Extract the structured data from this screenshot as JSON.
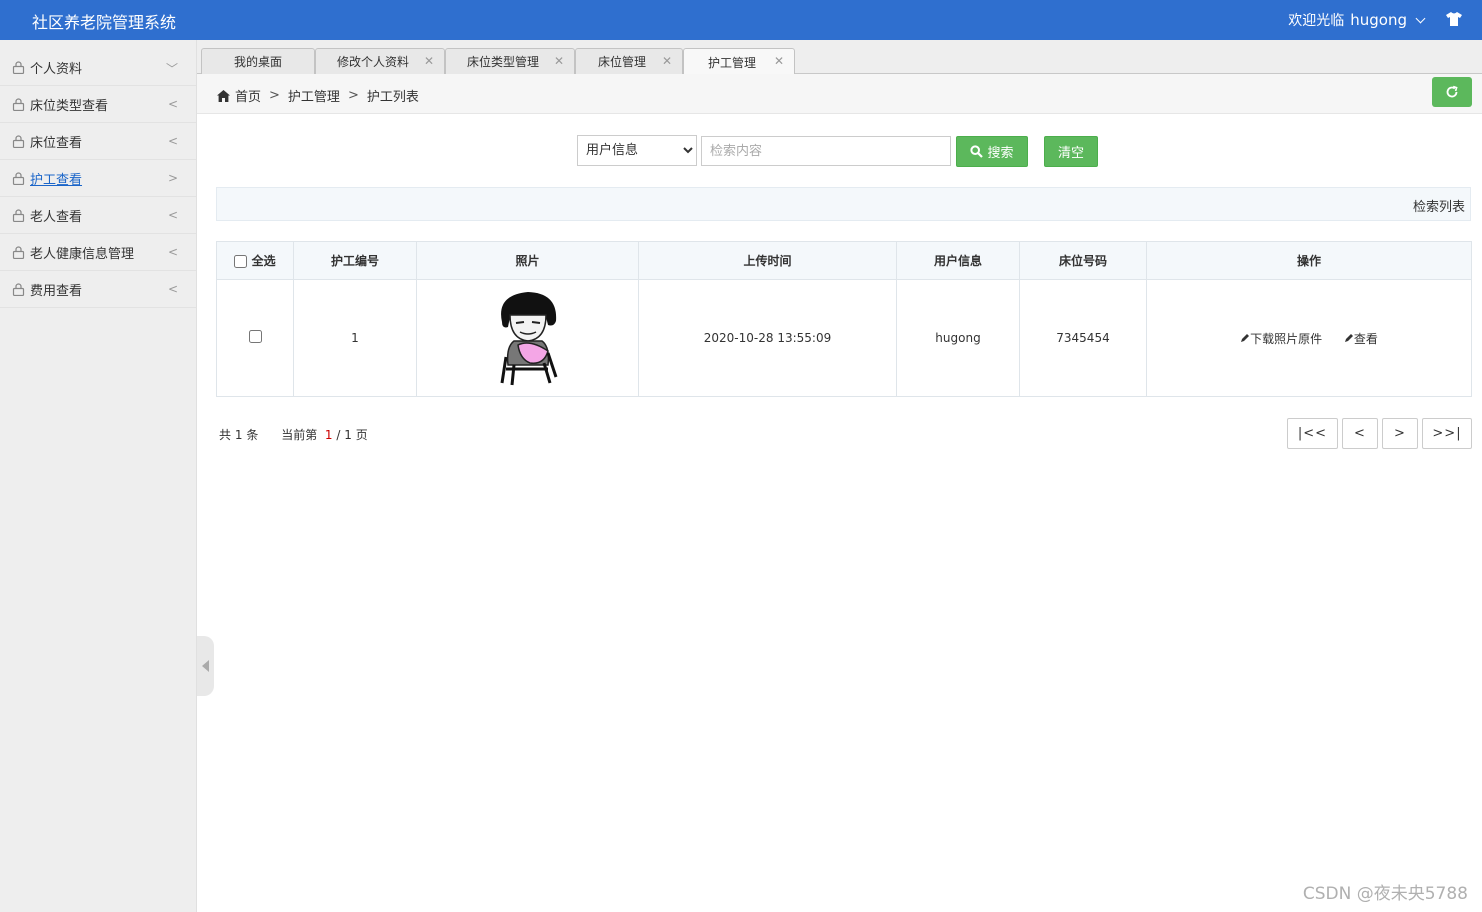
{
  "header": {
    "title": "社区养老院管理系统",
    "welcome": "欢迎光临",
    "username": "hugong",
    "shirt_icon": "shirt-icon"
  },
  "sidebar": {
    "items": [
      {
        "label": "个人资料",
        "arrow": "﹀"
      },
      {
        "label": "床位类型查看",
        "arrow": "<"
      },
      {
        "label": "床位查看",
        "arrow": "<"
      },
      {
        "label": "护工查看",
        "arrow": ">"
      },
      {
        "label": "老人查看",
        "arrow": "<"
      },
      {
        "label": "老人健康信息管理",
        "arrow": "<"
      },
      {
        "label": "费用查看",
        "arrow": "<"
      }
    ]
  },
  "tabs": [
    {
      "label": "我的桌面",
      "closable": false
    },
    {
      "label": "修改个人资料",
      "closable": true
    },
    {
      "label": "床位类型管理",
      "closable": true
    },
    {
      "label": "床位管理",
      "closable": true
    },
    {
      "label": "护工管理",
      "closable": true
    }
  ],
  "breadcrumb": {
    "home": "首页",
    "level1": "护工管理",
    "level2": "护工列表",
    "sep": ">"
  },
  "search": {
    "field_selected": "用户信息",
    "placeholder": "检索内容",
    "search_label": "搜索",
    "clear_label": "清空"
  },
  "list_strip_label": "检索列表",
  "table": {
    "headers": {
      "select_all": "全选",
      "id": "护工编号",
      "photo": "照片",
      "upload_time": "上传时间",
      "user_info": "用户信息",
      "bed_no": "床位号码",
      "ops": "操作"
    },
    "rows": [
      {
        "id": "1",
        "upload_time": "2020-10-28 13:55:09",
        "user_info": "hugong",
        "bed_no": "7345454",
        "op_download": "下载照片原件",
        "op_view": "查看"
      }
    ]
  },
  "pagination": {
    "total_prefix": "共",
    "total": "1",
    "total_suffix": "条",
    "current_prefix": "当前第",
    "current": "1",
    "slash": "/",
    "pages": "1",
    "pages_suffix": "页",
    "first": "|<<",
    "prev": "<",
    "next": ">",
    "last": ">>|"
  },
  "watermark": "CSDN @夜未央5788",
  "colors": {
    "header_bg": "#2f6fcf",
    "green": "#5cb85c",
    "active_link": "#1a65c9"
  }
}
